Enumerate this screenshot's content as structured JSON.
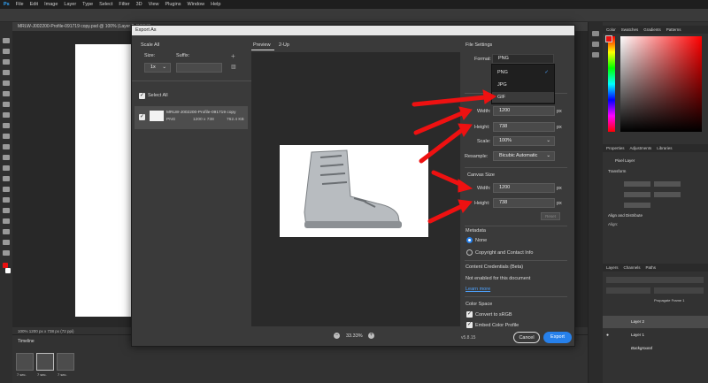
{
  "app": {
    "menu": [
      "Ps",
      "File",
      "Edit",
      "Image",
      "Layer",
      "Type",
      "Select",
      "Filter",
      "3D",
      "View",
      "Plugins",
      "Window",
      "Help"
    ],
    "doc_tab": "MRLW-J002200-Profile-091719 copy.psd @ 100% (Layer 2, RGB/8)",
    "status": "100%    1200 px x 738 px (72 ppi)",
    "timeline_title": "Timeline",
    "frame_delay": "7 sec.",
    "right_tabs_top": [
      "Color",
      "Swatches",
      "Gradients",
      "Patterns"
    ],
    "right_tabs_mid": [
      "Properties",
      "Adjustments",
      "Libraries"
    ],
    "properties": {
      "title": "Pixel Layer",
      "transform": "Transform",
      "align": "Align and Distribute",
      "align_sub": "Align:"
    },
    "right_tabs_bottom": [
      "Layers",
      "Channels",
      "Paths"
    ],
    "layers": [
      "Layer 2",
      "Layer 1",
      "Background"
    ],
    "propagate": "Propagate Frame 1",
    "colors": {
      "accent": "#2680eb",
      "foreground": "#e81010",
      "arrow": "#ee1111"
    }
  },
  "dialog": {
    "title": "Export As",
    "scale_all": "Scale All",
    "size_label": "Size:",
    "suffix_label": "Suffix:",
    "size_value": "1x",
    "select_all": "Select All",
    "asset": {
      "name": "MRLW-J002200-Profile-091719 copy",
      "format": "PNG",
      "dims": "1200 x 738",
      "filesize": "762.4 KB"
    },
    "preview_tabs": [
      "Preview",
      "2-Up"
    ],
    "zoom": "33.33%",
    "file_settings": "File Settings",
    "format_label": "Format:",
    "format_value": "PNG",
    "format_options": [
      "PNG",
      "JPG",
      "GIF"
    ],
    "width_label": "Width:",
    "height_label": "Height:",
    "width_value": "1200",
    "height_value": "738",
    "unit": "px",
    "scale_label": "Scale:",
    "scale_value": "100%",
    "resample_label": "Resample:",
    "resample_value": "Bicubic Automatic",
    "canvas_size": "Canvas Size",
    "canvas_width": "1200",
    "canvas_height": "738",
    "reset": "Reset",
    "metadata": "Metadata",
    "meta_none": "None",
    "meta_copyright": "Copyright and Contact Info",
    "content_credentials": "Content Credentials (Beta)",
    "not_enabled": "Not enabled for this document",
    "learn_more": "Learn more",
    "color_space": "Color Space",
    "convert_srgb": "Convert to sRGB",
    "embed_profile": "Embed Color Profile",
    "version": "v5.8.15",
    "cancel": "Cancel",
    "export": "Export"
  }
}
